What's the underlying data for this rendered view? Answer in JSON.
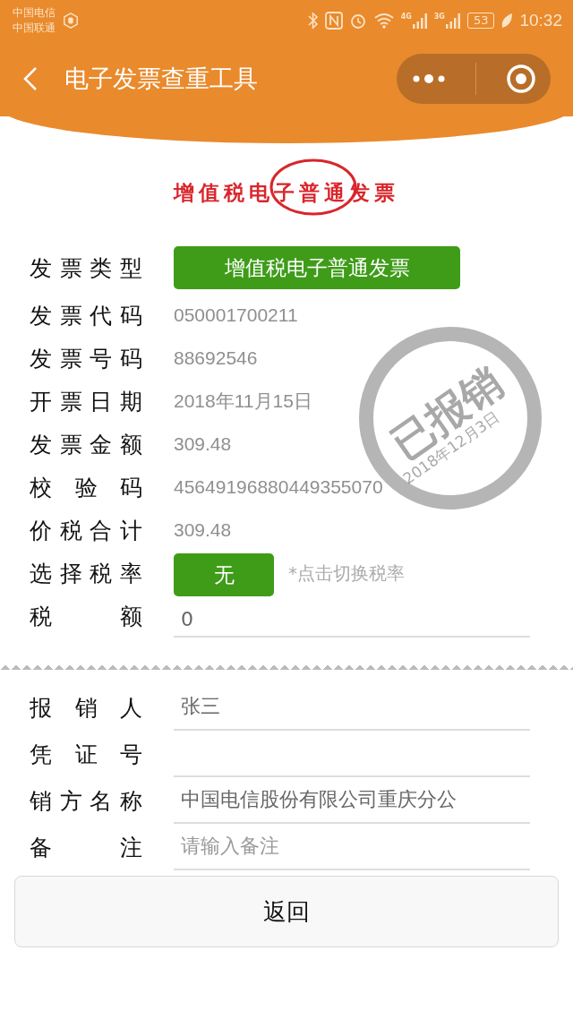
{
  "status_bar": {
    "carriers": [
      "中国电信",
      "中国联通"
    ],
    "network_labels": [
      "4G",
      "3G"
    ],
    "battery": "53",
    "time": "10:32"
  },
  "nav": {
    "title": "电子发票查重工具"
  },
  "invoice_logo": {
    "title": "增值税电子普通发票"
  },
  "invoice_rows": [
    {
      "kind": "select",
      "label": "发票类型",
      "value": "增值税电子普通发票"
    },
    {
      "kind": "text",
      "label": "发票代码",
      "value": "050001700211"
    },
    {
      "kind": "text",
      "label": "发票号码",
      "value": "88692546"
    },
    {
      "kind": "text",
      "label": "开票日期",
      "value": "2018年11月15日"
    },
    {
      "kind": "text",
      "label": "发票金额",
      "value": "309.48"
    },
    {
      "kind": "text",
      "label": "校验码",
      "value": "45649196880449355070"
    },
    {
      "kind": "text",
      "label": "价税合计",
      "value": "309.48"
    },
    {
      "kind": "rate",
      "label": "选择税率",
      "value": "无",
      "hint": "*点击切换税率"
    },
    {
      "kind": "field",
      "label": "税额",
      "value": "0"
    }
  ],
  "stamp": {
    "text": "已报销",
    "date": "2018年12月3日"
  },
  "form_rows": [
    {
      "label": "报销人",
      "value": "张三"
    },
    {
      "label": "凭证号"
    },
    {
      "label": "销方名称",
      "value": "中国电信股份有限公司重庆分公"
    },
    {
      "label": "备注",
      "placeholder": "请输入备注"
    }
  ],
  "back_button": "返回"
}
